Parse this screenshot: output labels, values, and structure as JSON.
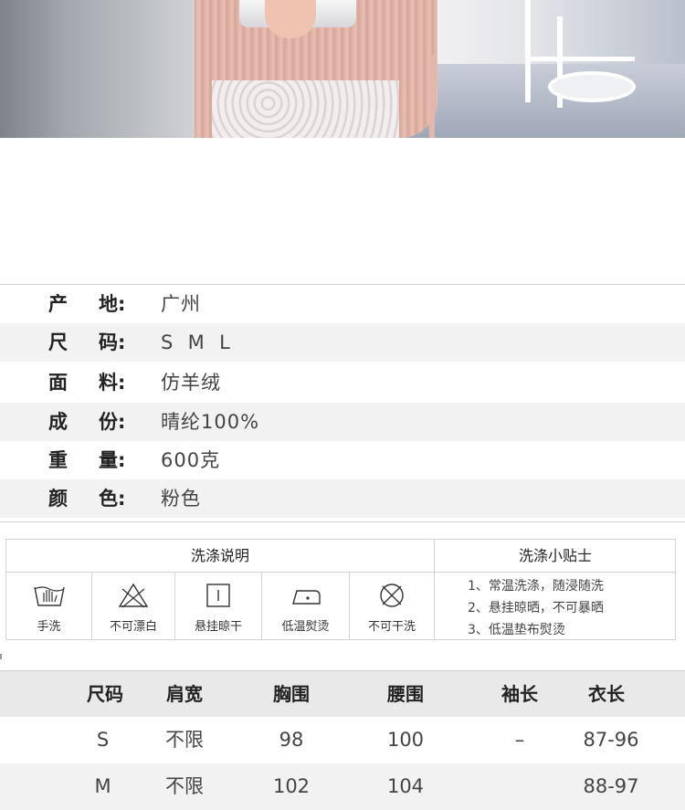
{
  "spec": [
    {
      "k1": "产",
      "k2": "地:",
      "value": "广州"
    },
    {
      "k1": "尺",
      "k2": "码:",
      "value": "S  M  L"
    },
    {
      "k1": "面",
      "k2": "料:",
      "value": "仿羊绒"
    },
    {
      "k1": "成",
      "k2": "份:",
      "value": "晴纶100%"
    },
    {
      "k1": "重",
      "k2": "量:",
      "value": "600克"
    },
    {
      "k1": "颜",
      "k2": "色:",
      "value": "粉色"
    }
  ],
  "wash": {
    "title": "洗涤说明",
    "tips_title": "洗涤小贴士",
    "items": [
      {
        "label": "手洗",
        "icon": "hand-wash-icon"
      },
      {
        "label": "不可漂白",
        "icon": "no-bleach-icon"
      },
      {
        "label": "悬挂晾干",
        "icon": "hang-dry-icon"
      },
      {
        "label": "低温熨烫",
        "icon": "low-iron-icon"
      },
      {
        "label": "不可干洗",
        "icon": "no-dry-clean-icon"
      }
    ],
    "tips": [
      "1、常温洗涤，随浸随洗",
      "2、悬挂晾晒，不可暴晒",
      "3、低温垫布熨烫"
    ]
  },
  "size_table": {
    "headers": [
      "尺码",
      "肩宽",
      "胸围",
      "腰围",
      "袖长",
      "衣长"
    ],
    "rows": [
      [
        "S",
        "不限",
        "98",
        "100",
        "–",
        "87-96"
      ],
      [
        "M",
        "不限",
        "102",
        "104",
        "",
        "88-97"
      ]
    ]
  }
}
